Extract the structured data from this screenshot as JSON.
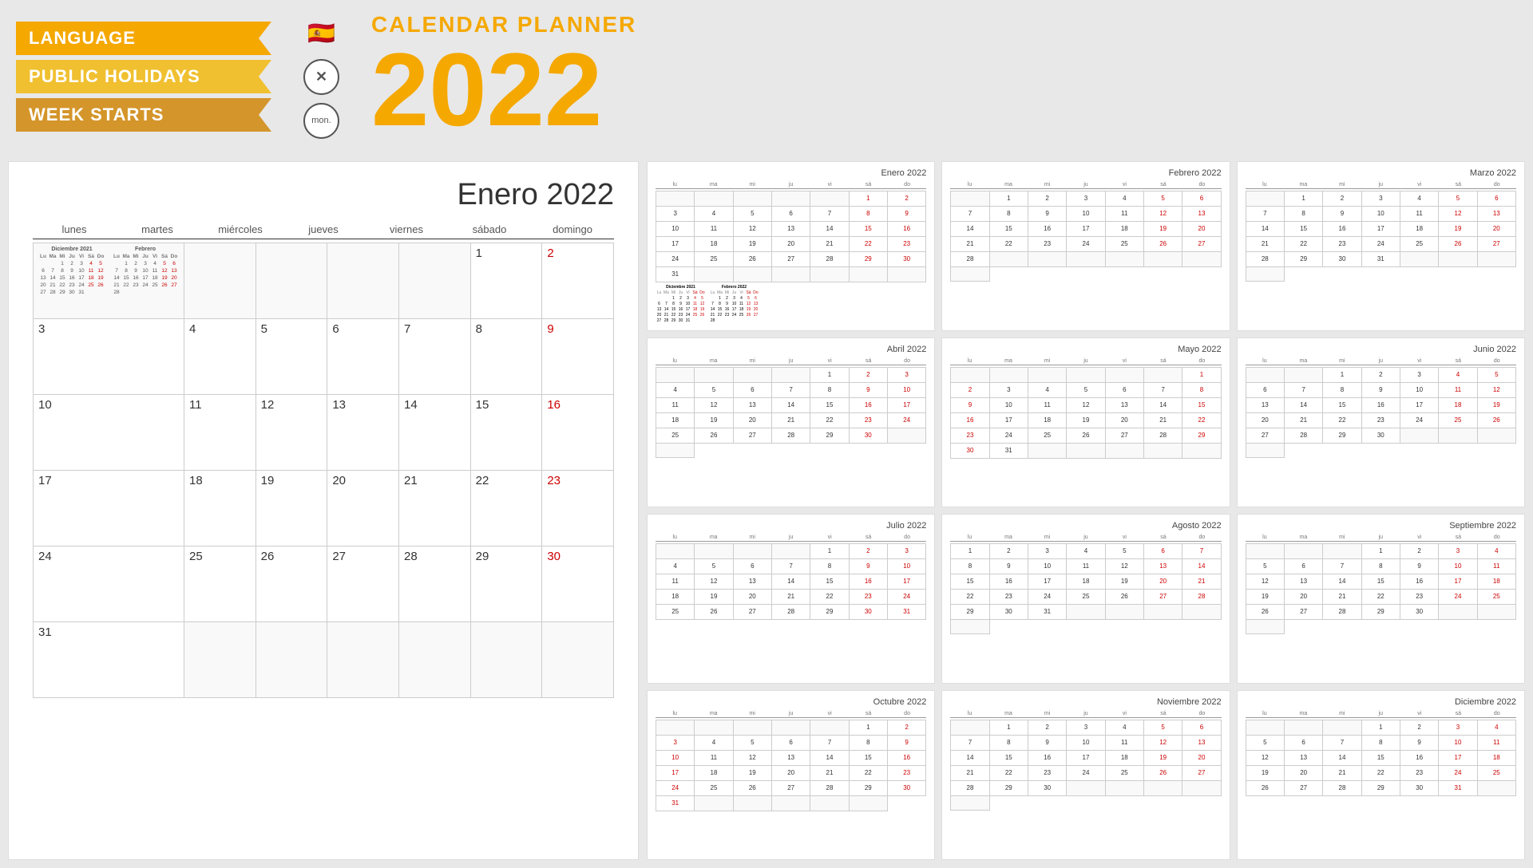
{
  "header": {
    "language_label": "LANGUAGE",
    "holidays_label": "PUBLIC HOLIDAYS",
    "week_label": "WEEK STARTS",
    "title": "CALENDAR PLANNER",
    "year": "2022",
    "flag_emoji": "🇪🇸",
    "no_holidays": "✕",
    "mon_label": "mon."
  },
  "big_calendar": {
    "month_title": "Enero 2022",
    "weekdays": [
      "lunes",
      "martes",
      "miércoles",
      "jueves",
      "viernes",
      "sábado",
      "domingo"
    ],
    "days": [
      {
        "day": "",
        "weekend": false,
        "empty": true
      },
      {
        "day": "",
        "weekend": false,
        "empty": true
      },
      {
        "day": "",
        "weekend": false,
        "empty": true
      },
      {
        "day": "",
        "weekend": false,
        "empty": true
      },
      {
        "day": "",
        "weekend": false,
        "empty": true
      },
      {
        "day": "1",
        "weekend": false,
        "empty": false
      },
      {
        "day": "2",
        "weekend": true,
        "empty": false
      },
      {
        "day": "3",
        "weekend": false,
        "empty": false
      },
      {
        "day": "4",
        "weekend": false,
        "empty": false
      },
      {
        "day": "5",
        "weekend": false,
        "empty": false
      },
      {
        "day": "6",
        "weekend": false,
        "empty": false
      },
      {
        "day": "7",
        "weekend": false,
        "empty": false
      },
      {
        "day": "8",
        "weekend": false,
        "empty": false
      },
      {
        "day": "9",
        "weekend": true,
        "empty": false
      },
      {
        "day": "10",
        "weekend": false,
        "empty": false
      },
      {
        "day": "11",
        "weekend": false,
        "empty": false
      },
      {
        "day": "12",
        "weekend": false,
        "empty": false
      },
      {
        "day": "13",
        "weekend": false,
        "empty": false
      },
      {
        "day": "14",
        "weekend": false,
        "empty": false
      },
      {
        "day": "15",
        "weekend": false,
        "empty": false
      },
      {
        "day": "16",
        "weekend": true,
        "empty": false
      },
      {
        "day": "17",
        "weekend": false,
        "empty": false
      },
      {
        "day": "18",
        "weekend": false,
        "empty": false
      },
      {
        "day": "19",
        "weekend": false,
        "empty": false
      },
      {
        "day": "20",
        "weekend": false,
        "empty": false
      },
      {
        "day": "21",
        "weekend": false,
        "empty": false
      },
      {
        "day": "22",
        "weekend": false,
        "empty": false
      },
      {
        "day": "23",
        "weekend": true,
        "empty": false
      },
      {
        "day": "24",
        "weekend": false,
        "empty": false
      },
      {
        "day": "25",
        "weekend": false,
        "empty": false
      },
      {
        "day": "26",
        "weekend": false,
        "empty": false
      },
      {
        "day": "27",
        "weekend": false,
        "empty": false
      },
      {
        "day": "28",
        "weekend": false,
        "empty": false
      },
      {
        "day": "29",
        "weekend": false,
        "empty": false
      },
      {
        "day": "30",
        "weekend": true,
        "empty": false
      },
      {
        "day": "31",
        "weekend": false,
        "empty": false
      },
      {
        "day": "",
        "weekend": false,
        "empty": true
      },
      {
        "day": "",
        "weekend": false,
        "empty": true
      },
      {
        "day": "",
        "weekend": false,
        "empty": true
      },
      {
        "day": "",
        "weekend": false,
        "empty": true
      },
      {
        "day": "",
        "weekend": false,
        "empty": true
      },
      {
        "day": "",
        "weekend": false,
        "empty": true
      }
    ]
  },
  "small_calendars": [
    {
      "title": "Enero 2022",
      "weekdays_short": [
        "lu",
        "ma",
        "mi",
        "ju",
        "vi",
        "sá",
        "do"
      ],
      "days": [
        "",
        "",
        "",
        "",
        "",
        "1",
        "2",
        "3",
        "4",
        "5",
        "6",
        "7",
        "8",
        "9",
        "10",
        "11",
        "12",
        "13",
        "14",
        "15",
        "16",
        "17",
        "18",
        "19",
        "20",
        "21",
        "22",
        "23",
        "24",
        "25",
        "26",
        "27",
        "28",
        "29",
        "30",
        "31",
        "",
        "",
        "",
        "",
        "",
        ""
      ],
      "weekends": [
        5,
        6,
        12,
        13,
        19,
        20,
        26,
        27,
        33,
        34
      ],
      "has_mini": true
    },
    {
      "title": "Febrero 2022",
      "weekdays_short": [
        "lu",
        "ma",
        "mi",
        "ju",
        "vi",
        "sá",
        "do"
      ],
      "days": [
        "",
        "1",
        "2",
        "3",
        "4",
        "5",
        "6",
        "7",
        "8",
        "9",
        "10",
        "11",
        "12",
        "13",
        "14",
        "15",
        "16",
        "17",
        "18",
        "19",
        "20",
        "21",
        "22",
        "23",
        "24",
        "25",
        "26",
        "27",
        "28",
        "",
        "",
        "",
        "",
        "",
        "",
        ""
      ],
      "weekends": [
        5,
        6,
        12,
        13,
        19,
        20,
        26,
        27
      ],
      "has_mini": true
    },
    {
      "title": "Marzo 2022",
      "weekdays_short": [
        "lu",
        "ma",
        "mi",
        "ju",
        "vi",
        "sá",
        "do"
      ],
      "days": [
        "",
        "1",
        "2",
        "3",
        "4",
        "5",
        "6",
        "7",
        "8",
        "9",
        "10",
        "11",
        "12",
        "13",
        "14",
        "15",
        "16",
        "17",
        "18",
        "19",
        "20",
        "21",
        "22",
        "23",
        "24",
        "25",
        "26",
        "27",
        "28",
        "29",
        "30",
        "31",
        "",
        "",
        "",
        ""
      ],
      "weekends": [
        5,
        6,
        12,
        13,
        19,
        20,
        26,
        27,
        33,
        34
      ],
      "has_mini": true
    },
    {
      "title": "Abril 2022",
      "weekdays_short": [
        "lu",
        "ma",
        "mi",
        "ju",
        "vi",
        "sá",
        "do"
      ],
      "days": [
        "",
        "",
        "",
        "",
        "1",
        "2",
        "3",
        "4",
        "5",
        "6",
        "7",
        "8",
        "9",
        "10",
        "11",
        "12",
        "13",
        "14",
        "15",
        "16",
        "17",
        "18",
        "19",
        "20",
        "21",
        "22",
        "23",
        "24",
        "25",
        "26",
        "27",
        "28",
        "29",
        "30",
        "",
        ""
      ],
      "weekends": [
        5,
        6,
        12,
        13,
        19,
        20,
        26,
        27
      ],
      "has_mini": true
    },
    {
      "title": "Mayo 2022",
      "weekdays_short": [
        "lu",
        "ma",
        "mi",
        "ju",
        "vi",
        "sá",
        "do"
      ],
      "days": [
        "",
        "",
        "",
        "",
        "",
        "",
        "1",
        "2",
        "3",
        "4",
        "5",
        "6",
        "7",
        "8",
        "9",
        "10",
        "11",
        "12",
        "13",
        "14",
        "15",
        "16",
        "17",
        "18",
        "19",
        "20",
        "21",
        "22",
        "23",
        "24",
        "25",
        "26",
        "27",
        "28",
        "29",
        "30",
        "31",
        "",
        "",
        "",
        "",
        ""
      ],
      "weekends": [
        6,
        7,
        13,
        14,
        20,
        21,
        27,
        28,
        34,
        35
      ],
      "has_mini": true
    },
    {
      "title": "Junio 2022",
      "weekdays_short": [
        "lu",
        "ma",
        "mi",
        "ju",
        "vi",
        "sá",
        "do"
      ],
      "days": [
        "",
        "",
        "1",
        "2",
        "3",
        "4",
        "5",
        "6",
        "7",
        "8",
        "9",
        "10",
        "11",
        "12",
        "13",
        "14",
        "15",
        "16",
        "17",
        "18",
        "19",
        "20",
        "21",
        "22",
        "23",
        "24",
        "25",
        "26",
        "27",
        "28",
        "29",
        "30",
        "",
        "",
        "",
        ""
      ],
      "weekends": [
        5,
        6,
        12,
        13,
        19,
        20,
        26,
        27,
        33,
        34
      ],
      "has_mini": true
    },
    {
      "title": "Julio 2022",
      "weekdays_short": [
        "lu",
        "ma",
        "mi",
        "ju",
        "vi",
        "sá",
        "do"
      ],
      "days": [
        "",
        "",
        "",
        "",
        "1",
        "2",
        "3",
        "4",
        "5",
        "6",
        "7",
        "8",
        "9",
        "10",
        "11",
        "12",
        "13",
        "14",
        "15",
        "16",
        "17",
        "18",
        "19",
        "20",
        "21",
        "22",
        "23",
        "24",
        "25",
        "26",
        "27",
        "28",
        "29",
        "30",
        "31"
      ],
      "weekends": [
        5,
        6,
        12,
        13,
        19,
        20,
        26,
        27,
        33,
        34
      ],
      "has_mini": true
    },
    {
      "title": "Agosto 2022",
      "weekdays_short": [
        "lu",
        "ma",
        "mi",
        "ju",
        "vi",
        "sá",
        "do"
      ],
      "days": [
        "1",
        "2",
        "3",
        "4",
        "5",
        "6",
        "7",
        "8",
        "9",
        "10",
        "11",
        "12",
        "13",
        "14",
        "15",
        "16",
        "17",
        "18",
        "19",
        "20",
        "21",
        "22",
        "23",
        "24",
        "25",
        "26",
        "27",
        "28",
        "29",
        "30",
        "31",
        "",
        "",
        "",
        "",
        ""
      ],
      "weekends": [
        5,
        6,
        12,
        13,
        19,
        20,
        26,
        27
      ],
      "has_mini": true
    },
    {
      "title": "Septiembre 2022",
      "weekdays_short": [
        "lu",
        "ma",
        "mi",
        "ju",
        "vi",
        "sá",
        "do"
      ],
      "days": [
        "",
        "",
        "",
        "1",
        "2",
        "3",
        "4",
        "5",
        "6",
        "7",
        "8",
        "9",
        "10",
        "11",
        "12",
        "13",
        "14",
        "15",
        "16",
        "17",
        "18",
        "19",
        "20",
        "21",
        "22",
        "23",
        "24",
        "25",
        "26",
        "27",
        "28",
        "29",
        "30",
        "",
        "",
        ""
      ],
      "weekends": [
        5,
        6,
        12,
        13,
        19,
        20,
        26,
        27
      ],
      "has_mini": true
    },
    {
      "title": "Octubre 2022",
      "weekdays_short": [
        "lu",
        "ma",
        "mi",
        "ju",
        "vi",
        "sá",
        "do"
      ],
      "days": [
        "",
        "",
        "",
        "",
        "",
        "1",
        "2",
        "3",
        "4",
        "5",
        "6",
        "7",
        "8",
        "9",
        "10",
        "11",
        "12",
        "13",
        "14",
        "15",
        "16",
        "17",
        "18",
        "19",
        "20",
        "21",
        "22",
        "23",
        "24",
        "25",
        "26",
        "27",
        "28",
        "29",
        "30",
        "31",
        "",
        "",
        "",
        "",
        ""
      ],
      "weekends": [
        6,
        7,
        13,
        14,
        20,
        21,
        27,
        28,
        34,
        35
      ],
      "has_mini": true
    },
    {
      "title": "Noviembre 2022",
      "weekdays_short": [
        "lu",
        "ma",
        "mi",
        "ju",
        "vi",
        "sá",
        "do"
      ],
      "days": [
        "",
        "1",
        "2",
        "3",
        "4",
        "5",
        "6",
        "7",
        "8",
        "9",
        "10",
        "11",
        "12",
        "13",
        "14",
        "15",
        "16",
        "17",
        "18",
        "19",
        "20",
        "21",
        "22",
        "23",
        "24",
        "25",
        "26",
        "27",
        "28",
        "29",
        "30",
        "",
        "",
        "",
        "",
        ""
      ],
      "weekends": [
        5,
        6,
        12,
        13,
        19,
        20,
        26,
        27
      ],
      "has_mini": true
    },
    {
      "title": "Diciembre 2022",
      "weekdays_short": [
        "lu",
        "ma",
        "mi",
        "ju",
        "vi",
        "sá",
        "do"
      ],
      "days": [
        "",
        "",
        "",
        "1",
        "2",
        "3",
        "4",
        "5",
        "6",
        "7",
        "8",
        "9",
        "10",
        "11",
        "12",
        "13",
        "14",
        "15",
        "16",
        "17",
        "18",
        "19",
        "20",
        "21",
        "22",
        "23",
        "24",
        "25",
        "26",
        "27",
        "28",
        "29",
        "30",
        "31",
        ""
      ],
      "weekends": [
        5,
        6,
        12,
        13,
        19,
        20,
        26,
        27,
        33,
        34
      ],
      "has_mini": true
    }
  ]
}
